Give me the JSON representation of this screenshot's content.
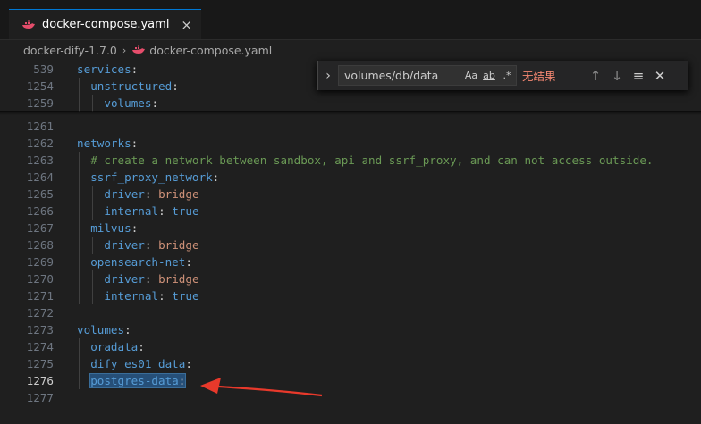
{
  "tab": {
    "title": "docker-compose.yaml",
    "close": "×"
  },
  "breadcrumb": {
    "folder": "docker-dify-1.7.0",
    "separator": "›",
    "file": "docker-compose.yaml"
  },
  "sticky": [
    {
      "num": "539",
      "indent": 0,
      "key": "services",
      "colon": ":",
      "val": ""
    },
    {
      "num": "1254",
      "indent": 1,
      "key": "unstructured",
      "colon": ":",
      "val": ""
    },
    {
      "num": "1259",
      "indent": 2,
      "key": "volumes",
      "colon": ":",
      "val": ""
    }
  ],
  "lines": [
    {
      "num": "1261",
      "indent": 0,
      "key": "",
      "colon": "",
      "val": ""
    },
    {
      "num": "1262",
      "indent": 0,
      "key": "networks",
      "colon": ":",
      "val": ""
    },
    {
      "num": "1263",
      "indent": 1,
      "comment": "# create a network between sandbox, api and ssrf_proxy, and can not access outside."
    },
    {
      "num": "1264",
      "indent": 1,
      "key": "ssrf_proxy_network",
      "colon": ":",
      "val": ""
    },
    {
      "num": "1265",
      "indent": 2,
      "key": "driver",
      "colon": ": ",
      "val": "bridge"
    },
    {
      "num": "1266",
      "indent": 2,
      "key": "internal",
      "colon": ": ",
      "val": "true",
      "bool": true
    },
    {
      "num": "1267",
      "indent": 1,
      "key": "milvus",
      "colon": ":",
      "val": ""
    },
    {
      "num": "1268",
      "indent": 2,
      "key": "driver",
      "colon": ": ",
      "val": "bridge"
    },
    {
      "num": "1269",
      "indent": 1,
      "key": "opensearch-net",
      "colon": ":",
      "val": ""
    },
    {
      "num": "1270",
      "indent": 2,
      "key": "driver",
      "colon": ": ",
      "val": "bridge"
    },
    {
      "num": "1271",
      "indent": 2,
      "key": "internal",
      "colon": ": ",
      "val": "true",
      "bool": true
    },
    {
      "num": "1272",
      "indent": 0,
      "key": "",
      "colon": "",
      "val": ""
    },
    {
      "num": "1273",
      "indent": 0,
      "key": "volumes",
      "colon": ":",
      "val": ""
    },
    {
      "num": "1274",
      "indent": 1,
      "key": "oradata",
      "colon": ":",
      "val": ""
    },
    {
      "num": "1275",
      "indent": 1,
      "key": "dify_es01_data",
      "colon": ":",
      "val": ""
    },
    {
      "num": "1276",
      "indent": 1,
      "key": "postgres-data",
      "colon": ":",
      "val": "",
      "selected": true,
      "active": true
    },
    {
      "num": "1277",
      "indent": 0,
      "key": "",
      "colon": "",
      "val": ""
    }
  ],
  "find": {
    "query": "volumes/db/data",
    "toggle": "›",
    "match_case": "Aa",
    "whole_word": "ab",
    "regex": ".*",
    "result": "无结果",
    "prev": "↑",
    "next": "↓",
    "in_selection": "≡",
    "close": "✕"
  },
  "colors": {
    "key": "#569cd6",
    "string": "#ce9178",
    "comment": "#6a9955",
    "arrow": "#e8392b"
  }
}
